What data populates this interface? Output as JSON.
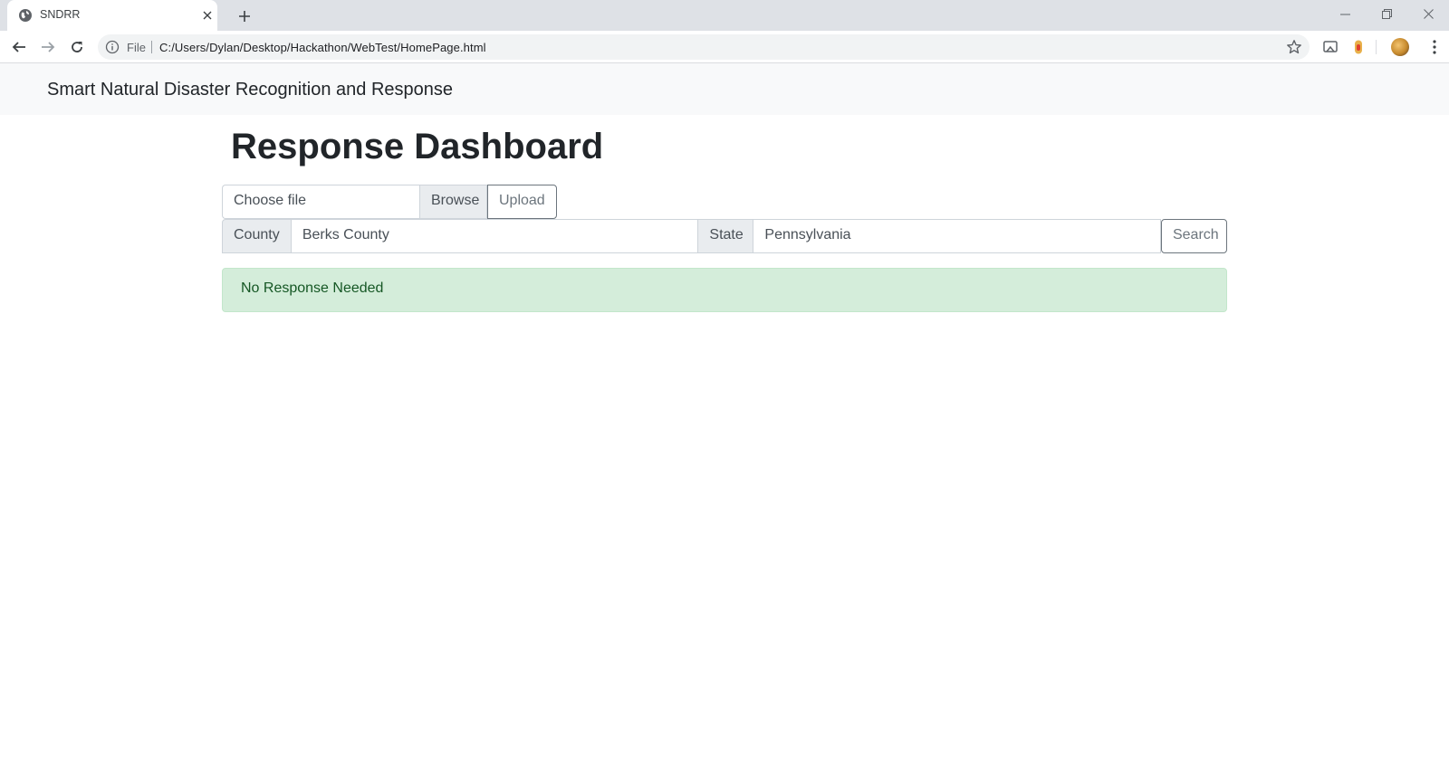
{
  "browser": {
    "tab": {
      "title": "SNDRR"
    },
    "address": {
      "scheme": "File",
      "url": "C:/Users/Dylan/Desktop/Hackathon/WebTest/HomePage.html"
    }
  },
  "navbar": {
    "brand": "Smart Natural Disaster Recognition and Response"
  },
  "page": {
    "title": "Response Dashboard"
  },
  "upload": {
    "file_placeholder": "Choose file",
    "browse_label": "Browse",
    "upload_label": "Upload"
  },
  "search": {
    "county_label": "County",
    "county_value": "Berks County",
    "state_label": "State",
    "state_value": "Pennsylvania",
    "search_label": "Search"
  },
  "alert": {
    "message": "No Response Needed",
    "color": "#155724",
    "background": "#d4edda"
  }
}
